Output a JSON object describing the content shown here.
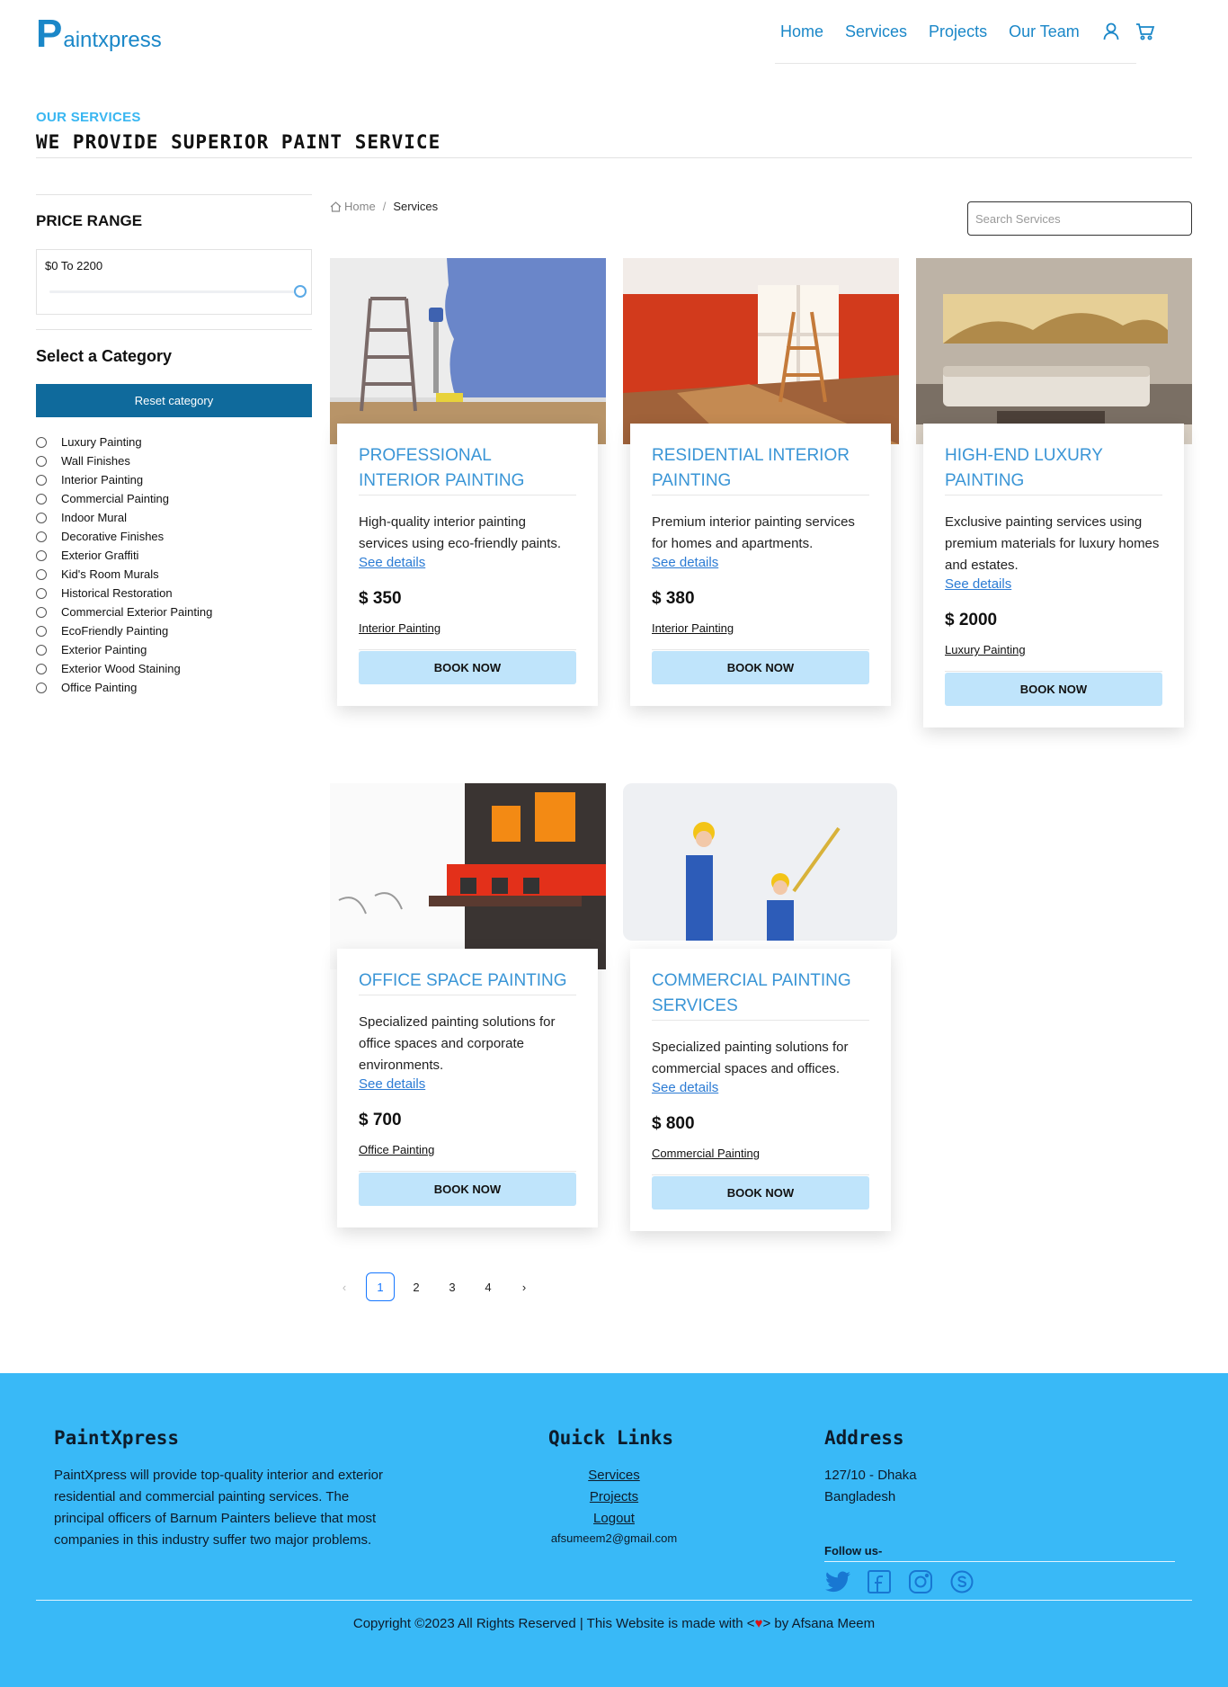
{
  "brand": {
    "logo_initial": "P",
    "logo_rest": "aintxpress"
  },
  "nav": {
    "items": [
      "Home",
      "Services",
      "Projects",
      "Our Team"
    ]
  },
  "section": {
    "subtitle": "OUR SERVICES",
    "title": "WE PROVIDE SUPERIOR PAINT SERVICE"
  },
  "sidebar": {
    "price_title": "PRICE RANGE",
    "price_text": "$0 To 2200",
    "category_title": "Select a Category",
    "reset_label": "Reset category",
    "categories": [
      "Luxury Painting",
      "Wall Finishes",
      "Interior Painting",
      "Commercial Painting",
      "Indoor Mural",
      "Decorative Finishes",
      "Exterior Graffiti",
      "Kid's Room Murals",
      "Historical Restoration",
      "Commercial Exterior Painting",
      "EcoFriendly Painting",
      "Exterior Painting",
      "Exterior Wood Staining",
      "Office Painting"
    ]
  },
  "breadcrumb": {
    "home": "Home",
    "separator": "/",
    "current": "Services"
  },
  "search": {
    "placeholder": "Search Services",
    "value": ""
  },
  "cards": [
    {
      "title": "PROFESSIONAL INTERIOR PAINTING",
      "desc": "High-quality interior painting services using eco-friendly paints.",
      "link": "See details",
      "price": "$ 350",
      "category": "Interior Painting",
      "button": "BOOK NOW"
    },
    {
      "title": "RESIDENTIAL INTERIOR PAINTING",
      "desc": "Premium interior painting services for homes and apartments.",
      "link": "See details",
      "price": "$ 380",
      "category": "Interior Painting",
      "button": "BOOK NOW"
    },
    {
      "title": "HIGH-END LUXURY PAINTING",
      "desc": "Exclusive painting services using premium materials for luxury homes and estates.",
      "link": "See details",
      "price": "$ 2000",
      "category": "Luxury Painting",
      "button": "BOOK NOW"
    },
    {
      "title": "OFFICE SPACE PAINTING",
      "desc": "Specialized painting solutions for office spaces and corporate environments.",
      "link": "See details",
      "price": "$ 700",
      "category": "Office Painting",
      "button": "BOOK NOW"
    },
    {
      "title": "COMMERCIAL PAINTING SERVICES",
      "desc": "Specialized painting solutions for commercial spaces and offices.",
      "link": "See details",
      "price": "$ 800",
      "category": "Commercial Painting",
      "button": "BOOK NOW"
    }
  ],
  "pagination": {
    "pages": [
      "1",
      "2",
      "3",
      "4"
    ],
    "current": "1",
    "prev": "‹",
    "next": "›"
  },
  "footer": {
    "about_title": "PaintXpress",
    "about_text": "PaintXpress will provide top-quality interior and exterior residential and commercial painting services. The principal officers of Barnum Painters believe that most companies in this industry suffer two major problems.",
    "links_title": "Quick Links",
    "links": [
      "Services",
      "Projects",
      "Logout"
    ],
    "email": "afsumeem2@gmail.com",
    "address_title": "Address",
    "address_line1": "127/10 - Dhaka",
    "address_line2": "Bangladesh",
    "follow": "Follow us-",
    "copyright_before": "Copyright ©2023 All Rights Reserved | This Website is made with <",
    "copyright_heart": "♥",
    "copyright_after": "> by Afsana Meem"
  },
  "colors": {
    "brand_blue": "#1a87c8",
    "light_blue": "#38b6f1",
    "footer_bg": "#39b9f7",
    "button_bg": "#bfe4fb",
    "reset_bg": "#0f6a9c"
  },
  "icons": [
    "user-icon",
    "cart-icon",
    "home-icon",
    "twitter-icon",
    "facebook-icon",
    "instagram-icon",
    "skype-icon"
  ]
}
